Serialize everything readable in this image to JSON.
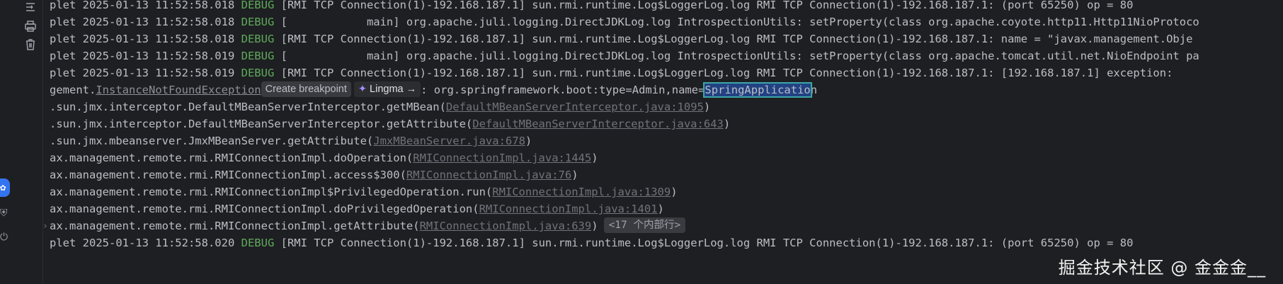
{
  "gutter": {
    "icons": [
      "soft-wrap-icon",
      "print-icon",
      "trash-icon"
    ],
    "side_tabs": [
      "lingma-tab-icon",
      "structure-tab-icon",
      "services-tab-icon"
    ]
  },
  "console": {
    "lines": [
      {
        "prefix": "plet 2025-01-13 11:52:58.018 ",
        "level": "DEBUG",
        "text": " [RMI TCP Connection(1)-192.168.187.1] sun.rmi.runtime.Log$LoggerLog.log RMI TCP Connection(1)-192.168.187.1: (port 65250) op = 80"
      },
      {
        "prefix": "plet 2025-01-13 11:52:58.018 ",
        "level": "DEBUG",
        "text": " [            main] org.apache.juli.logging.DirectJDKLog.log IntrospectionUtils: setProperty(class org.apache.coyote.http11.Http11NioProtoco"
      },
      {
        "prefix": "plet 2025-01-13 11:52:58.018 ",
        "level": "DEBUG",
        "text": " [RMI TCP Connection(1)-192.168.187.1] sun.rmi.runtime.Log$LoggerLog.log RMI TCP Connection(1)-192.168.187.1: name = \"javax.management.Obje"
      },
      {
        "prefix": "plet 2025-01-13 11:52:58.019 ",
        "level": "DEBUG",
        "text": " [            main] org.apache.juli.logging.DirectJDKLog.log IntrospectionUtils: setProperty(class org.apache.tomcat.util.net.NioEndpoint pa"
      },
      {
        "prefix": "plet 2025-01-13 11:52:58.019 ",
        "level": "DEBUG",
        "text": " [RMI TCP Connection(1)-192.168.187.1] sun.rmi.runtime.Log$LoggerLog.log RMI TCP Connection(1)-192.168.187.1: [192.168.187.1] exception:"
      }
    ],
    "exception_line": {
      "prefix": "gement.",
      "link": "InstanceNotFoundException",
      "hint": "Create breakpoint",
      "lingma": "Lingma",
      "lingma_arrow": "→",
      "middle": ": org.springframework.boot:type=Admin,name=",
      "selected": "SpringApplicatio",
      "suffix": "n"
    },
    "stack": [
      {
        "text": ".sun.jmx.interceptor.DefaultMBeanServerInterceptor.getMBean(",
        "link": "DefaultMBeanServerInterceptor.java:1095",
        "end": ")"
      },
      {
        "text": ".sun.jmx.interceptor.DefaultMBeanServerInterceptor.getAttribute(",
        "link": "DefaultMBeanServerInterceptor.java:643",
        "end": ")"
      },
      {
        "text": ".sun.jmx.mbeanserver.JmxMBeanServer.getAttribute(",
        "link": "JmxMBeanServer.java:678",
        "end": ")"
      },
      {
        "text": "ax.management.remote.rmi.RMIConnectionImpl.doOperation(",
        "link": "RMIConnectionImpl.java:1445",
        "end": ")"
      },
      {
        "text": "ax.management.remote.rmi.RMIConnectionImpl.access$300(",
        "link": "RMIConnectionImpl.java:76",
        "end": ")"
      },
      {
        "text": "ax.management.remote.rmi.RMIConnectionImpl$PrivilegedOperation.run(",
        "link": "RMIConnectionImpl.java:1309",
        "end": ")"
      },
      {
        "text": "ax.management.remote.rmi.RMIConnectionImpl.doPrivilegedOperation(",
        "link": "RMIConnectionImpl.java:1401",
        "end": ")"
      }
    ],
    "last_stack": {
      "text": "ax.management.remote.rmi.RMIConnectionImpl.getAttribute(",
      "link": "RMIConnectionImpl.java:639",
      "end": ")",
      "collapsed": "<17 个内部行>",
      "fold": "›"
    },
    "final_line": {
      "prefix": "plet 2025-01-13 11:52:58.020 ",
      "level": "DEBUG",
      "text": " [RMI TCP Connection(1)-192.168.187.1] sun.rmi.runtime.Log$LoggerLog.log RMI TCP Connection(1)-192.168.187.1: (port 65250) op = 80"
    }
  },
  "watermark": "掘金技术社区 @ 金金金__",
  "colors": {
    "background": "#1e1f22",
    "debug": "#5faa5c",
    "link": "#6f737a",
    "selection": "#214283",
    "accent": "#3574f0"
  }
}
